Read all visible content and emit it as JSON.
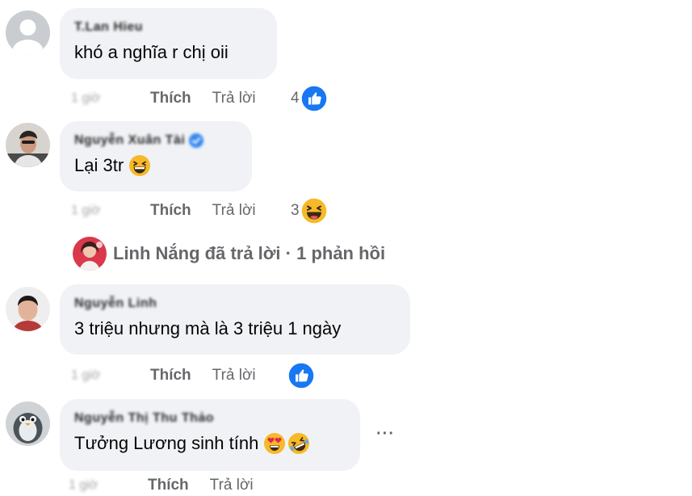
{
  "comments": [
    {
      "author": "T.Lan Hieu",
      "text": "khó a nghĩa r chị oii",
      "time": "1 giờ",
      "like_label": "Thích",
      "reply_label": "Trả lời",
      "reaction_count": "4",
      "reaction_icon": "like-icon"
    },
    {
      "author": "Nguyễn Xuân Tài",
      "verified": true,
      "text": "Lại 3tr",
      "text_emoji": "laughing-emoji",
      "time": "1 giờ",
      "like_label": "Thích",
      "reply_label": "Trả lời",
      "reaction_count": "3",
      "reaction_icon": "haha-icon"
    },
    {
      "author": "Nguyễn Linh",
      "text": "3 triệu nhưng mà là 3 triệu 1 ngày",
      "time": "1 giờ",
      "like_label": "Thích",
      "reply_label": "Trả lời",
      "reaction_count": "",
      "reaction_icon": "like-icon"
    },
    {
      "author": "Nguyễn Thị Thu Thảo",
      "text": "Tưởng Lương sinh tính",
      "text_emojis": [
        "heart-eyes-emoji",
        "rofl-emoji"
      ],
      "time": "1 giờ",
      "like_label": "Thích",
      "reply_label": "Trả lời"
    }
  ],
  "replies_summary": {
    "text": "Linh Nắng đã trả lời · 1 phản hồi"
  },
  "more_label": "···",
  "colors": {
    "bubble_bg": "#f0f2f5",
    "meta_text": "#65676b",
    "like_blue": "#1877f2",
    "emoji_yellow": "#f7b928"
  }
}
